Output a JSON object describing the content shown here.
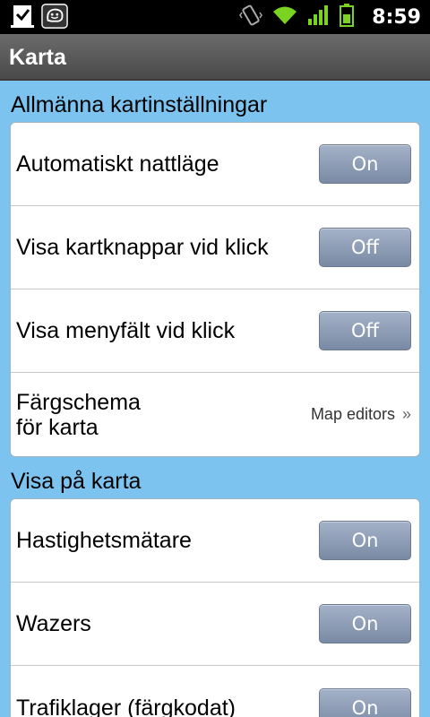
{
  "status_bar": {
    "time": "8:59",
    "icons": [
      "download-done-icon",
      "waze-icon",
      "vibrate-icon",
      "wifi-icon",
      "signal-icon",
      "battery-icon"
    ]
  },
  "header": {
    "title": "Karta"
  },
  "sections": [
    {
      "title": "Allmänna kartinställningar",
      "rows": [
        {
          "label": "Automatiskt nattläge",
          "value": "On"
        },
        {
          "label": "Visa kartknappar vid klick",
          "value": "Off"
        },
        {
          "label": "Visa menyfält vid klick",
          "value": "Off"
        },
        {
          "label": "Färgschema för karta",
          "value": "Map editors"
        }
      ]
    },
    {
      "title": "Visa på karta",
      "rows": [
        {
          "label": "Hastighetsmätare",
          "value": "On"
        },
        {
          "label": "Wazers",
          "value": "On"
        },
        {
          "label": "Trafiklager (färgkodat)",
          "value": "On"
        }
      ]
    }
  ],
  "colors": {
    "background": "#7cc3ef",
    "toggle": "#8e9cb6",
    "titlebar": "#5a5a5a"
  }
}
